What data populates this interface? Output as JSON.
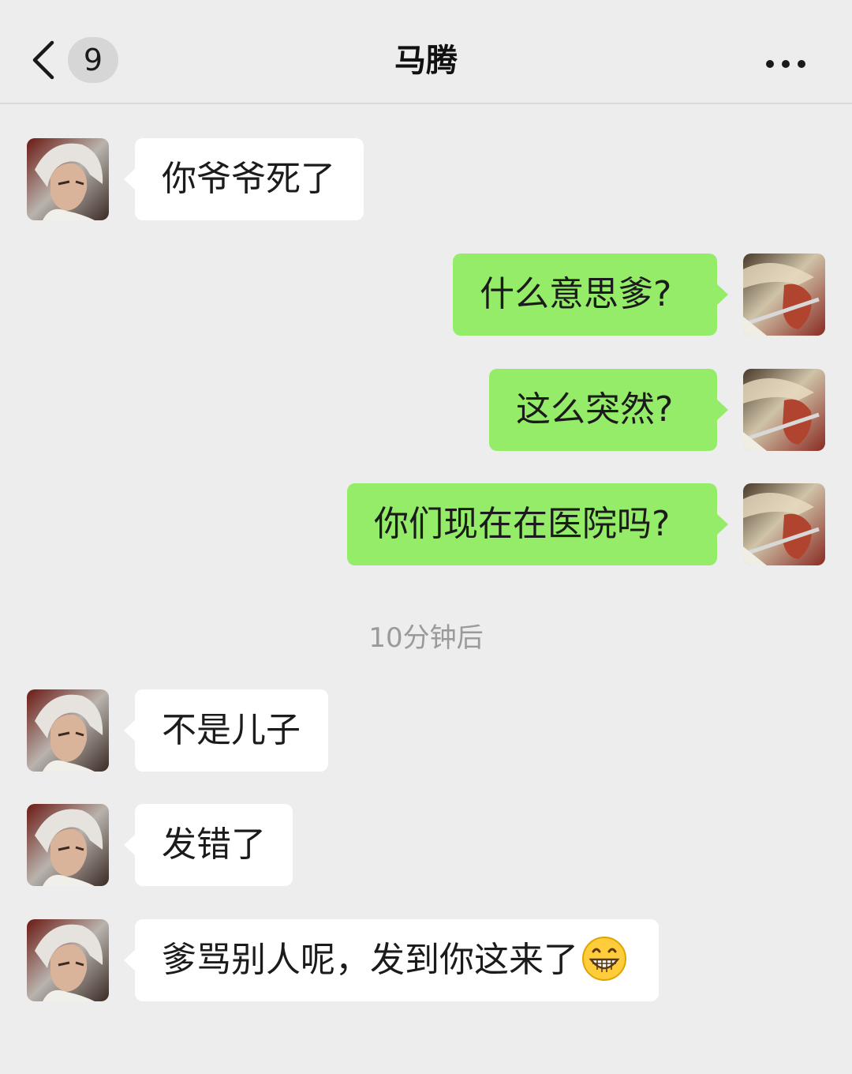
{
  "header": {
    "title": "马腾",
    "unread_count": "9",
    "back_icon": "chevron-left-icon",
    "more_icon": "more-dots-icon"
  },
  "colors": {
    "background": "#ededed",
    "outgoing_bubble": "#95ec69",
    "incoming_bubble": "#ffffff",
    "timestamp_text": "#9a9a9a"
  },
  "messages": [
    {
      "direction": "incoming",
      "text": "你爷爷死了"
    },
    {
      "direction": "outgoing",
      "text": "什么意思爹?"
    },
    {
      "direction": "outgoing",
      "text": "这么突然?"
    },
    {
      "direction": "outgoing",
      "text": "你们现在在医院吗?"
    },
    {
      "type": "timestamp",
      "text": "10分钟后"
    },
    {
      "direction": "incoming",
      "text": "不是儿子"
    },
    {
      "direction": "incoming",
      "text": "发错了"
    },
    {
      "direction": "incoming",
      "text": "爹骂别人呢，发到你这来了",
      "emoji": "grinning-face-icon"
    }
  ]
}
